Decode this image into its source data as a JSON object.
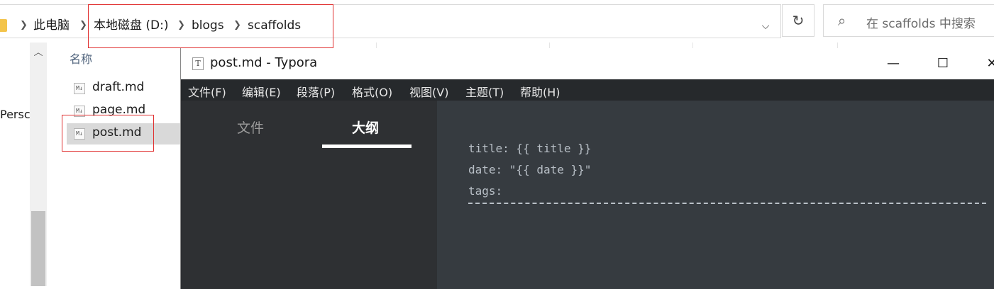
{
  "explorer": {
    "breadcrumb": [
      "此电脑",
      "本地磁盘 (D:)",
      "blogs",
      "scaffolds"
    ],
    "search_placeholder": "在 scaffolds 中搜索",
    "nav_item_partial": "Persc",
    "column_name": "名称",
    "files": [
      {
        "name": "draft.md",
        "selected": false
      },
      {
        "name": "page.md",
        "selected": false
      },
      {
        "name": "post.md",
        "selected": true
      }
    ],
    "icons": {
      "back": "chevron-right-icon",
      "dropdown": "chevron-down-icon",
      "refresh": "refresh-icon",
      "search": "search-icon",
      "md_badge": "M↓"
    }
  },
  "typora": {
    "title": "post.md - Typora",
    "app_icon": "T",
    "window_buttons": {
      "minimize": "—",
      "maximize": "☐",
      "close": "✕"
    },
    "menu": [
      "文件(F)",
      "编辑(E)",
      "段落(P)",
      "格式(O)",
      "视图(V)",
      "主题(T)",
      "帮助(H)"
    ],
    "sidebar_tabs": [
      {
        "label": "文件",
        "active": false
      },
      {
        "label": "大纲",
        "active": true
      }
    ],
    "content_lines": [
      "title: {{ title }}",
      "date: \"{{ date }}\"",
      "tags:"
    ]
  },
  "colors": {
    "highlight_red": "#e03030",
    "editor_bg": "#363b40",
    "menubar_bg": "#26292c",
    "sidebar_bg": "#2e3033"
  }
}
